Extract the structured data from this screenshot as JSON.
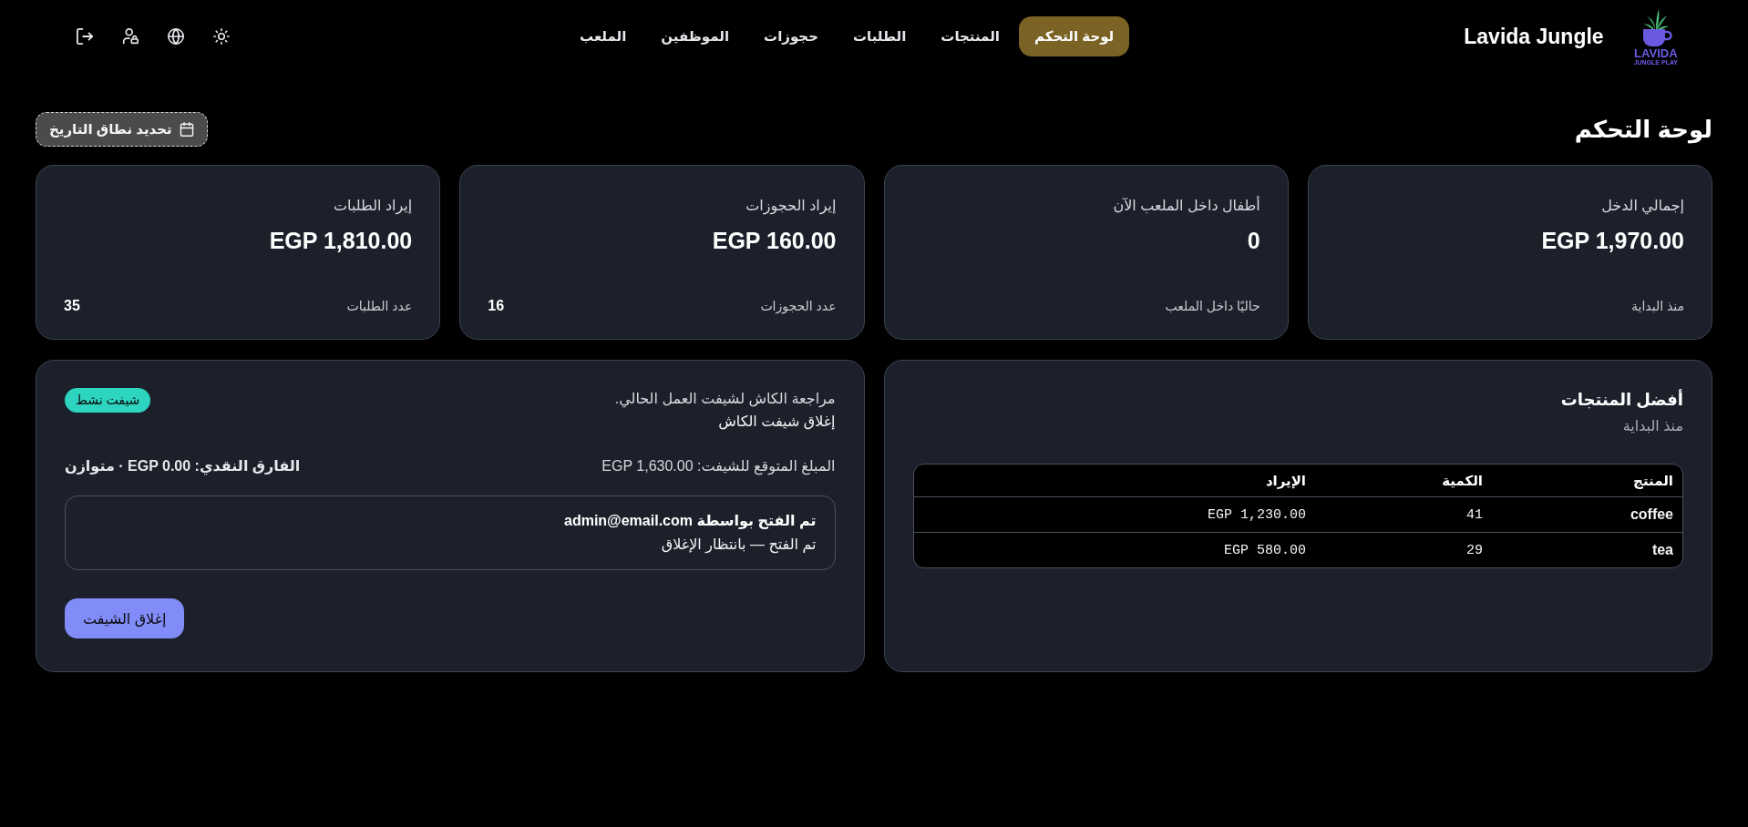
{
  "header": {
    "logo": {
      "title": "LAVIDA",
      "tagline": "JUNGLE PLAY"
    },
    "brand": "Lavida Jungle",
    "nav": [
      {
        "label": "لوحة التحكم",
        "selected": true
      },
      {
        "label": "المنتجات",
        "selected": false
      },
      {
        "label": "الطلبات",
        "selected": false
      },
      {
        "label": "حجوزات",
        "selected": false
      },
      {
        "label": "الموظفين",
        "selected": false
      },
      {
        "label": "الملعب",
        "selected": false
      }
    ]
  },
  "page": {
    "title": "لوحة التحكم",
    "date_range_button": "تحديد نطاق التاريخ"
  },
  "stat_cards": [
    {
      "label": "إجمالي الدخل",
      "value": "EGP 1,970.00",
      "footer_label": "منذ البداية"
    },
    {
      "label": "أطفال داخل الملعب الآن",
      "value": "0",
      "footer_label": "حاليًا داخل الملعب"
    },
    {
      "label": "إيراد الحجوزات",
      "value": "EGP 160.00",
      "footer_label": "عدد الحجوزات",
      "footer_value": "16"
    },
    {
      "label": "إيراد الطلبات",
      "value": "EGP 1,810.00",
      "footer_label": "عدد الطلبات",
      "footer_value": "35"
    }
  ],
  "top_products": {
    "title": "أفضل المنتجات",
    "subtitle": "منذ البداية",
    "table": {
      "columns": [
        "المنتج",
        "الكمية",
        "الإيراد"
      ],
      "rows": [
        [
          "coffee",
          "41",
          "EGP 1,230.00"
        ],
        [
          "tea",
          "29",
          "EGP 580.00"
        ]
      ]
    }
  },
  "cash_shift": {
    "description": "مراجعة الكاش لشيفت العمل الحالي.",
    "title": "إغلاق شيفت الكاش",
    "badge": "شيفت نشط",
    "expected": "المبلغ المتوقع للشيفت: EGP 1,630.00",
    "difference": "الفارق النقدي: EGP 0.00 · متوازن",
    "opened_by": "تم الفتح بواسطة admin@email.com",
    "status": "تم الفتح — بانتظار الإغلاق",
    "button": "إغلاق الشيفت"
  }
}
